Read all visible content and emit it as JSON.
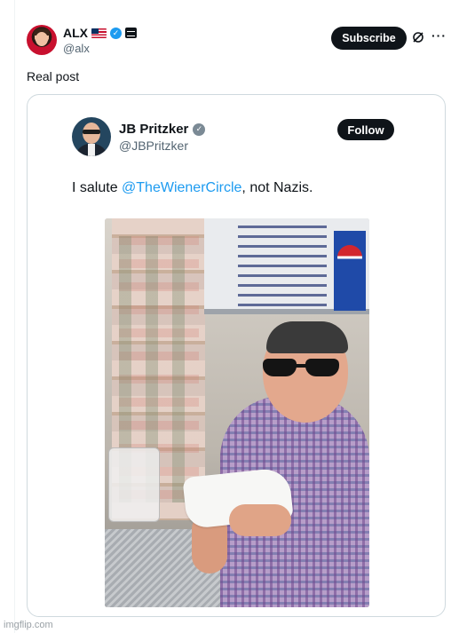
{
  "post": {
    "author": {
      "display_name": "ALX",
      "handle": "@alx",
      "badges": [
        "us-flag-icon",
        "verified-icon",
        "affiliate-badge-icon"
      ]
    },
    "subscribe_label": "Subscribe",
    "text": "Real post"
  },
  "quote": {
    "author": {
      "display_name": "JB Pritzker",
      "handle": "@JBPritzker",
      "verified": "gray-verified-icon"
    },
    "follow_label": "Follow",
    "text_before": "I salute ",
    "mention": "@TheWienerCircle",
    "text_after": ", not Nazis."
  },
  "watermark": "imgflip.com",
  "colors": {
    "primary_text": "#0f1419",
    "secondary_text": "#536471",
    "mention": "#1d9bf0",
    "button_bg": "#0f1419",
    "border": "#cfd9de"
  }
}
